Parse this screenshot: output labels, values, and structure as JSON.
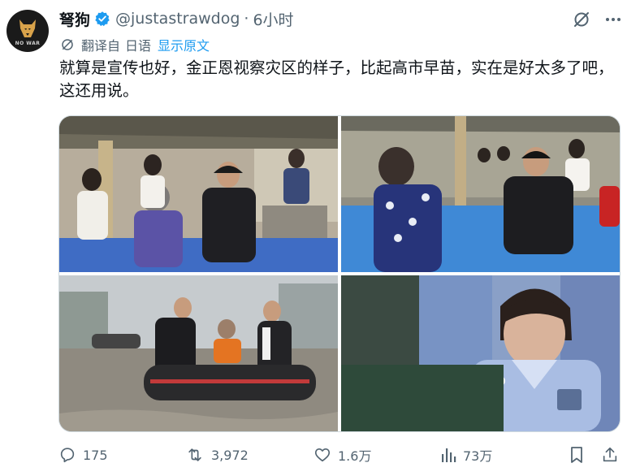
{
  "author": {
    "name": "弩狗",
    "handle": "@justastrawdog",
    "separator": "·",
    "time": "6小时",
    "avatar_text": "NO WAR",
    "verified_icon": "verified-badge-icon"
  },
  "translation": {
    "label": "翻译自",
    "language": "日语",
    "show_original": "显示原文"
  },
  "tweet": {
    "text": "就算是宣传也好，金正恩视察灾区的样子，比起高市早苗，实在是好太多了吧，这还用说。"
  },
  "media": {
    "count": 4,
    "photos": [
      "photo-tent-visit-1",
      "photo-tent-visit-2",
      "photo-flood-boat",
      "photo-takaichi-uniform"
    ]
  },
  "actions": {
    "replies": "175",
    "reposts": "3,972",
    "likes": "1.6万",
    "views": "73万"
  },
  "colors": {
    "accent": "#1d9bf0",
    "muted": "#536471",
    "text": "#0f1419"
  }
}
